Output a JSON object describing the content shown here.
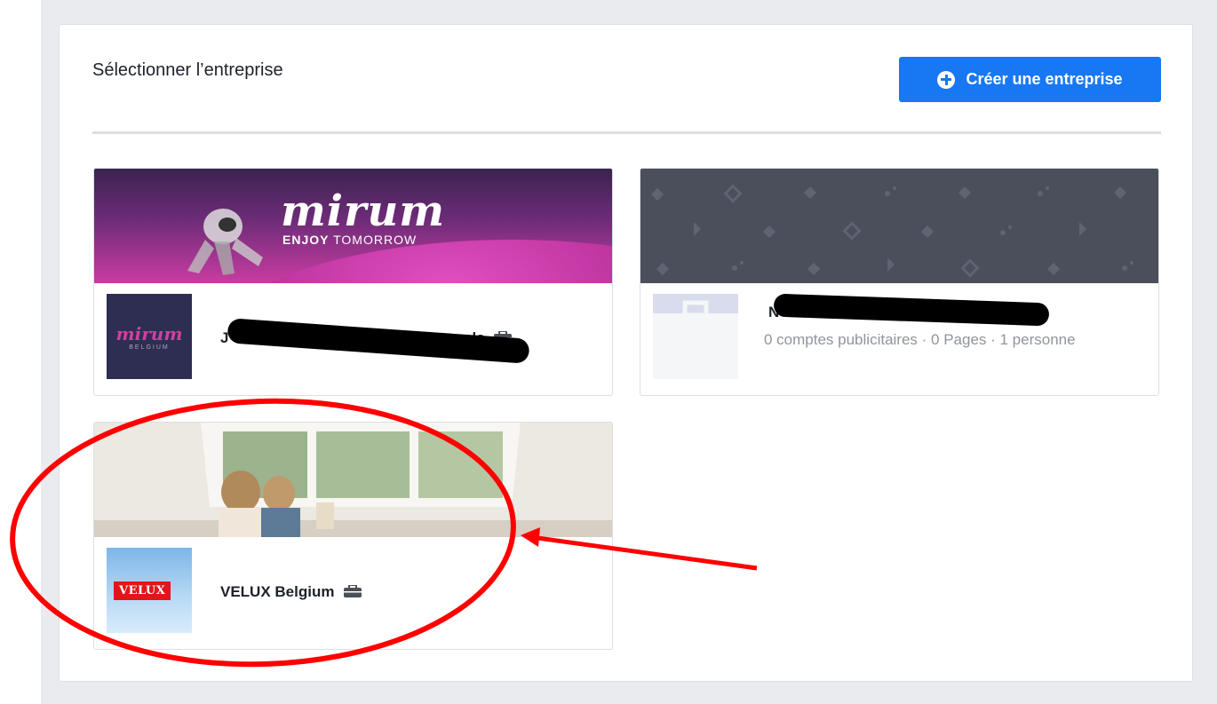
{
  "page": {
    "title": "Sélectionner l’entreprise",
    "create_button": "Créer une entreprise"
  },
  "businesses": [
    {
      "name": "",
      "meta": "",
      "cover_text": {
        "logo": "mirum",
        "tagline_bold": "ENJOY",
        "tagline_rest": " TOMORROW"
      },
      "thumb_text": {
        "logo": "mirum",
        "sub": "BELGIUM"
      },
      "partial_name_prefix": "J",
      "partial_name_suffix": "als"
    },
    {
      "name": "",
      "meta": "0 comptes publicitaires · 0 Pages · 1 personne",
      "partial_name_prefix": "N"
    },
    {
      "name": "VELUX Belgium",
      "meta": "",
      "thumb_text": {
        "logo": "VELUX"
      }
    }
  ],
  "colors": {
    "primary_button": "#1877f2",
    "annotation_red": "#ff0000"
  },
  "icons": [
    "plus-circle-icon",
    "briefcase-icon"
  ]
}
